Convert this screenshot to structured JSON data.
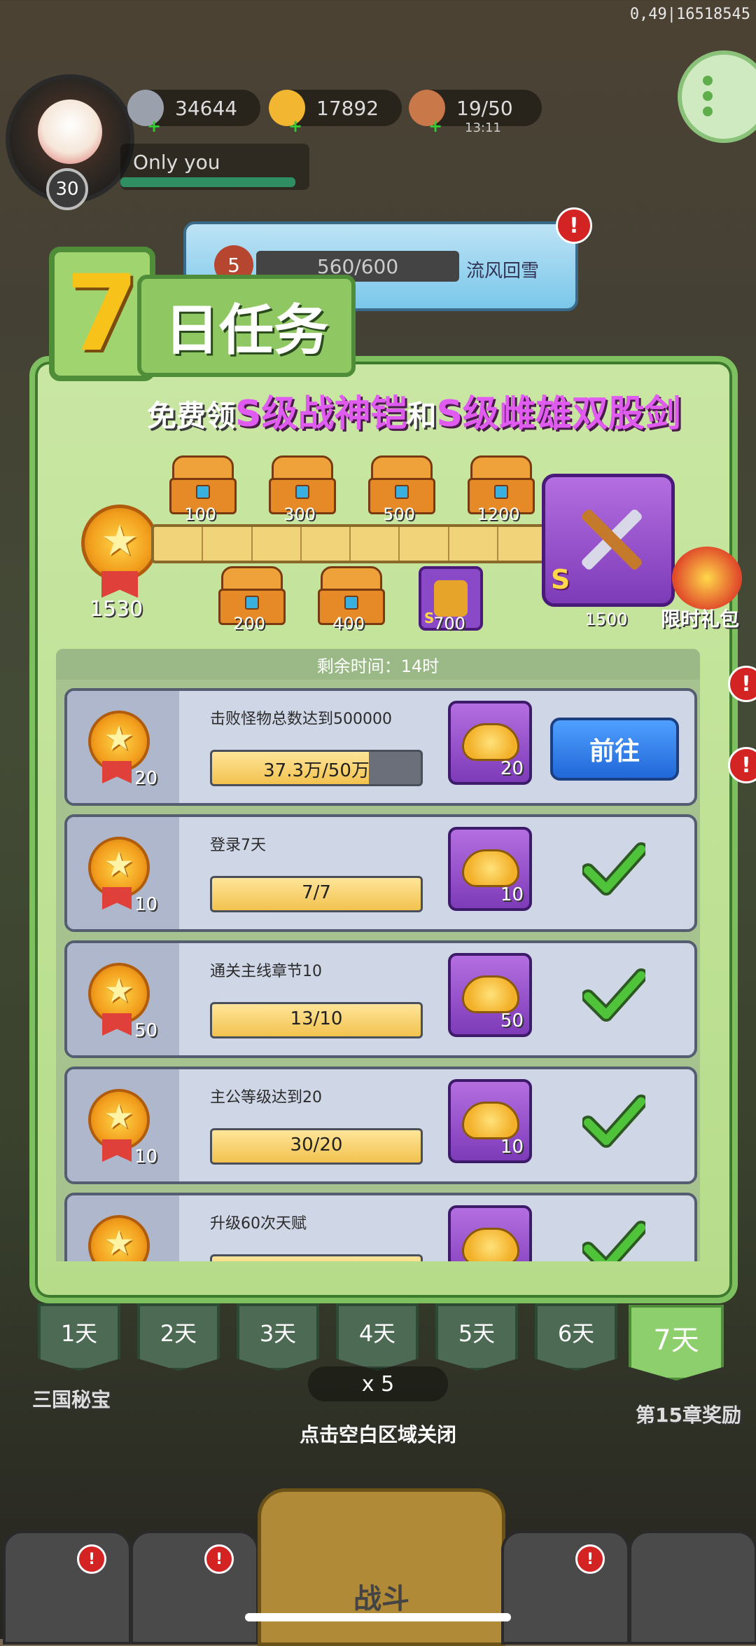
{
  "hud": {
    "coords": "0,49|16518545",
    "player_level": "30",
    "player_name": "Only you",
    "silver": "34644",
    "gold": "17892",
    "stamina": "19/50",
    "stamina_timer": "13:11",
    "stage_level": "5",
    "stage_progress": "560/600",
    "stage_name": "流风回雪"
  },
  "event": {
    "title_number": "7",
    "title_text": "日任务",
    "subtitle_prefix": "免费领",
    "subtitle_item1": "S级战神铠",
    "subtitle_mid": "和",
    "subtitle_item2": "S级雌雄双股剑",
    "total_points": "1530",
    "milestones_top": [
      "100",
      "300",
      "500",
      "1200"
    ],
    "milestones_bottom": [
      "200",
      "400",
      "700"
    ],
    "final_milestone": "1500",
    "reward_grade": "S",
    "gift_label": "限时礼包",
    "remaining_time": "剩余时间：14时"
  },
  "tasks": [
    {
      "desc": "击败怪物总数达到500000",
      "progress": "37.3万/50万",
      "fill": 0.75,
      "points": "20",
      "reward": "20",
      "status": "go",
      "go_label": "前往"
    },
    {
      "desc": "登录7天",
      "progress": "7/7",
      "fill": 1,
      "points": "10",
      "reward": "10",
      "status": "done"
    },
    {
      "desc": "通关主线章节10",
      "progress": "13/10",
      "fill": 1,
      "points": "50",
      "reward": "50",
      "status": "done"
    },
    {
      "desc": "主公等级达到20",
      "progress": "30/20",
      "fill": 1,
      "points": "10",
      "reward": "10",
      "status": "done"
    },
    {
      "desc": "升级60次天赋",
      "progress": "",
      "fill": 1,
      "points": "",
      "reward": "",
      "status": "done"
    }
  ],
  "days": [
    "1天",
    "2天",
    "3天",
    "4天",
    "5天",
    "6天",
    "7天"
  ],
  "active_day": "7天",
  "close_hint": "点击空白区域关闭",
  "meat_count": "x 5",
  "left_side_label": "三国秘宝",
  "right_side_label": "第15章奖励",
  "nav": {
    "battle_label": "战斗"
  },
  "colors": {
    "panel": "#b6dc8a",
    "accent_purple": "#7d3bb8",
    "go_button": "#2167d8",
    "check": "#4fc33a"
  }
}
